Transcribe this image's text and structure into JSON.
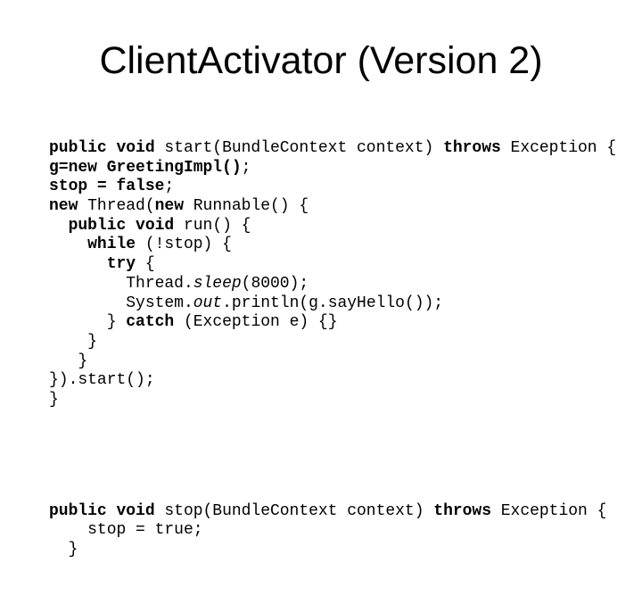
{
  "slide": {
    "title": "ClientActivator (Version 2)",
    "code_start": [
      [
        {
          "t": "public void",
          "s": "kw"
        },
        {
          "t": " start(BundleContext context) "
        },
        {
          "t": "throws",
          "s": "kw"
        },
        {
          "t": " Exception {"
        }
      ],
      [
        {
          "t": "g=new GreetingImpl()",
          "s": "kw"
        },
        {
          "t": ";"
        }
      ],
      [
        {
          "t": "stop = false",
          "s": "kw"
        },
        {
          "t": ";"
        }
      ],
      [
        {
          "t": "new",
          "s": "kw"
        },
        {
          "t": " Thread("
        },
        {
          "t": "new",
          "s": "kw"
        },
        {
          "t": " Runnable() {"
        }
      ],
      [
        {
          "t": "  "
        },
        {
          "t": "public void",
          "s": "kw"
        },
        {
          "t": " run() {"
        }
      ],
      [
        {
          "t": "    "
        },
        {
          "t": "while",
          "s": "kw"
        },
        {
          "t": " (!stop) {"
        }
      ],
      [
        {
          "t": "      "
        },
        {
          "t": "try",
          "s": "kw"
        },
        {
          "t": " {"
        }
      ],
      [
        {
          "t": "        Thread."
        },
        {
          "t": "sleep",
          "s": "it"
        },
        {
          "t": "(8000);"
        }
      ],
      [
        {
          "t": "        System."
        },
        {
          "t": "out",
          "s": "it"
        },
        {
          "t": ".println(g.sayHello());"
        }
      ],
      [
        {
          "t": "      } "
        },
        {
          "t": "catch",
          "s": "kw"
        },
        {
          "t": " (Exception e) {}"
        }
      ],
      [
        {
          "t": "    }"
        }
      ],
      [
        {
          "t": "   }"
        }
      ],
      [
        {
          "t": "}).start();"
        }
      ],
      [
        {
          "t": "}"
        }
      ]
    ],
    "code_stop": [
      [
        {
          "t": "public void",
          "s": "kw"
        },
        {
          "t": " stop(BundleContext context) "
        },
        {
          "t": "throws",
          "s": "kw"
        },
        {
          "t": " Exception {"
        }
      ],
      [
        {
          "t": "    stop = true;"
        }
      ],
      [
        {
          "t": "  }"
        }
      ]
    ]
  }
}
